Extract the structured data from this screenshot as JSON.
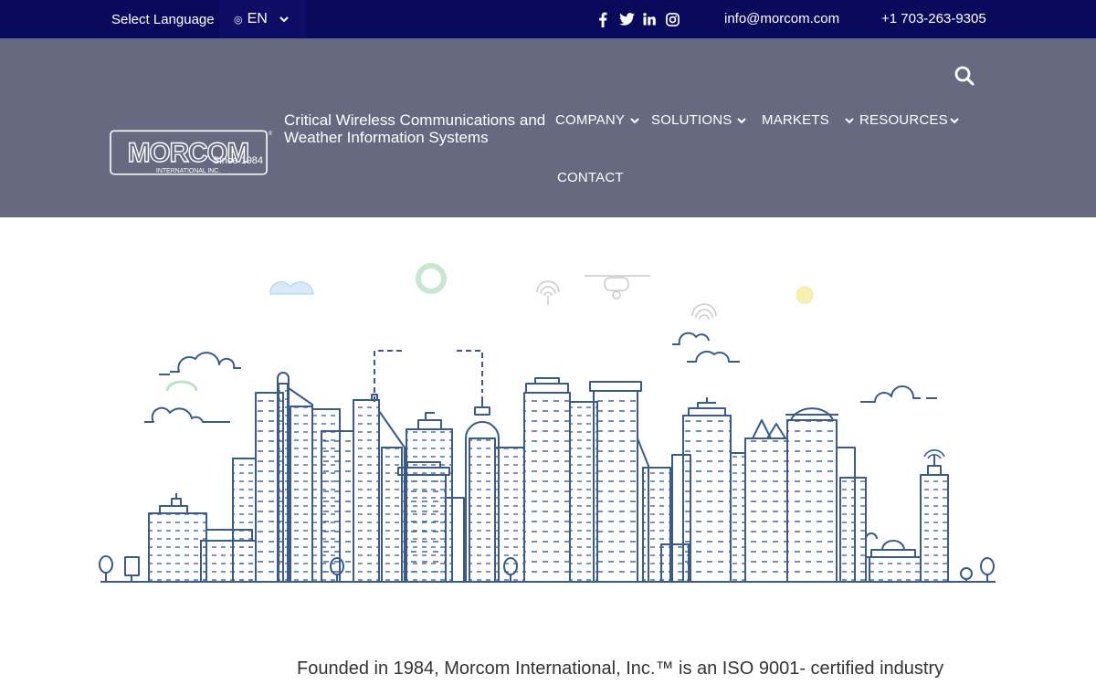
{
  "topbar": {
    "language_label": "Select Language",
    "language_value": "EN",
    "social": [
      {
        "icon": "facebook-icon"
      },
      {
        "icon": "twitter-icon"
      },
      {
        "icon": "linkedin-icon"
      },
      {
        "icon": "instagram-icon"
      }
    ],
    "email": "info@morcom.com",
    "phone": "+1 703-263-9305"
  },
  "header": {
    "logo_text": "MORCOM",
    "logo_subtext": "INTERNATIONAL INC.",
    "since": "Since 1984",
    "tagline": "Critical Wireless Communications and Weather Information Systems",
    "nav": {
      "company": "COMPANY",
      "solutions": "SOLUTIONS",
      "markets": "MARKETS",
      "resources": "RESOURCES",
      "contact": "CONTACT"
    }
  },
  "main": {
    "intro": "Founded in 1984, Morcom International, Inc.™ is an ISO 9001- certified industry"
  },
  "colors": {
    "topbar": "#0a0a5c",
    "header": "#666a80",
    "line_art": "#3a5a8c",
    "accent_green": "#3cb371"
  }
}
